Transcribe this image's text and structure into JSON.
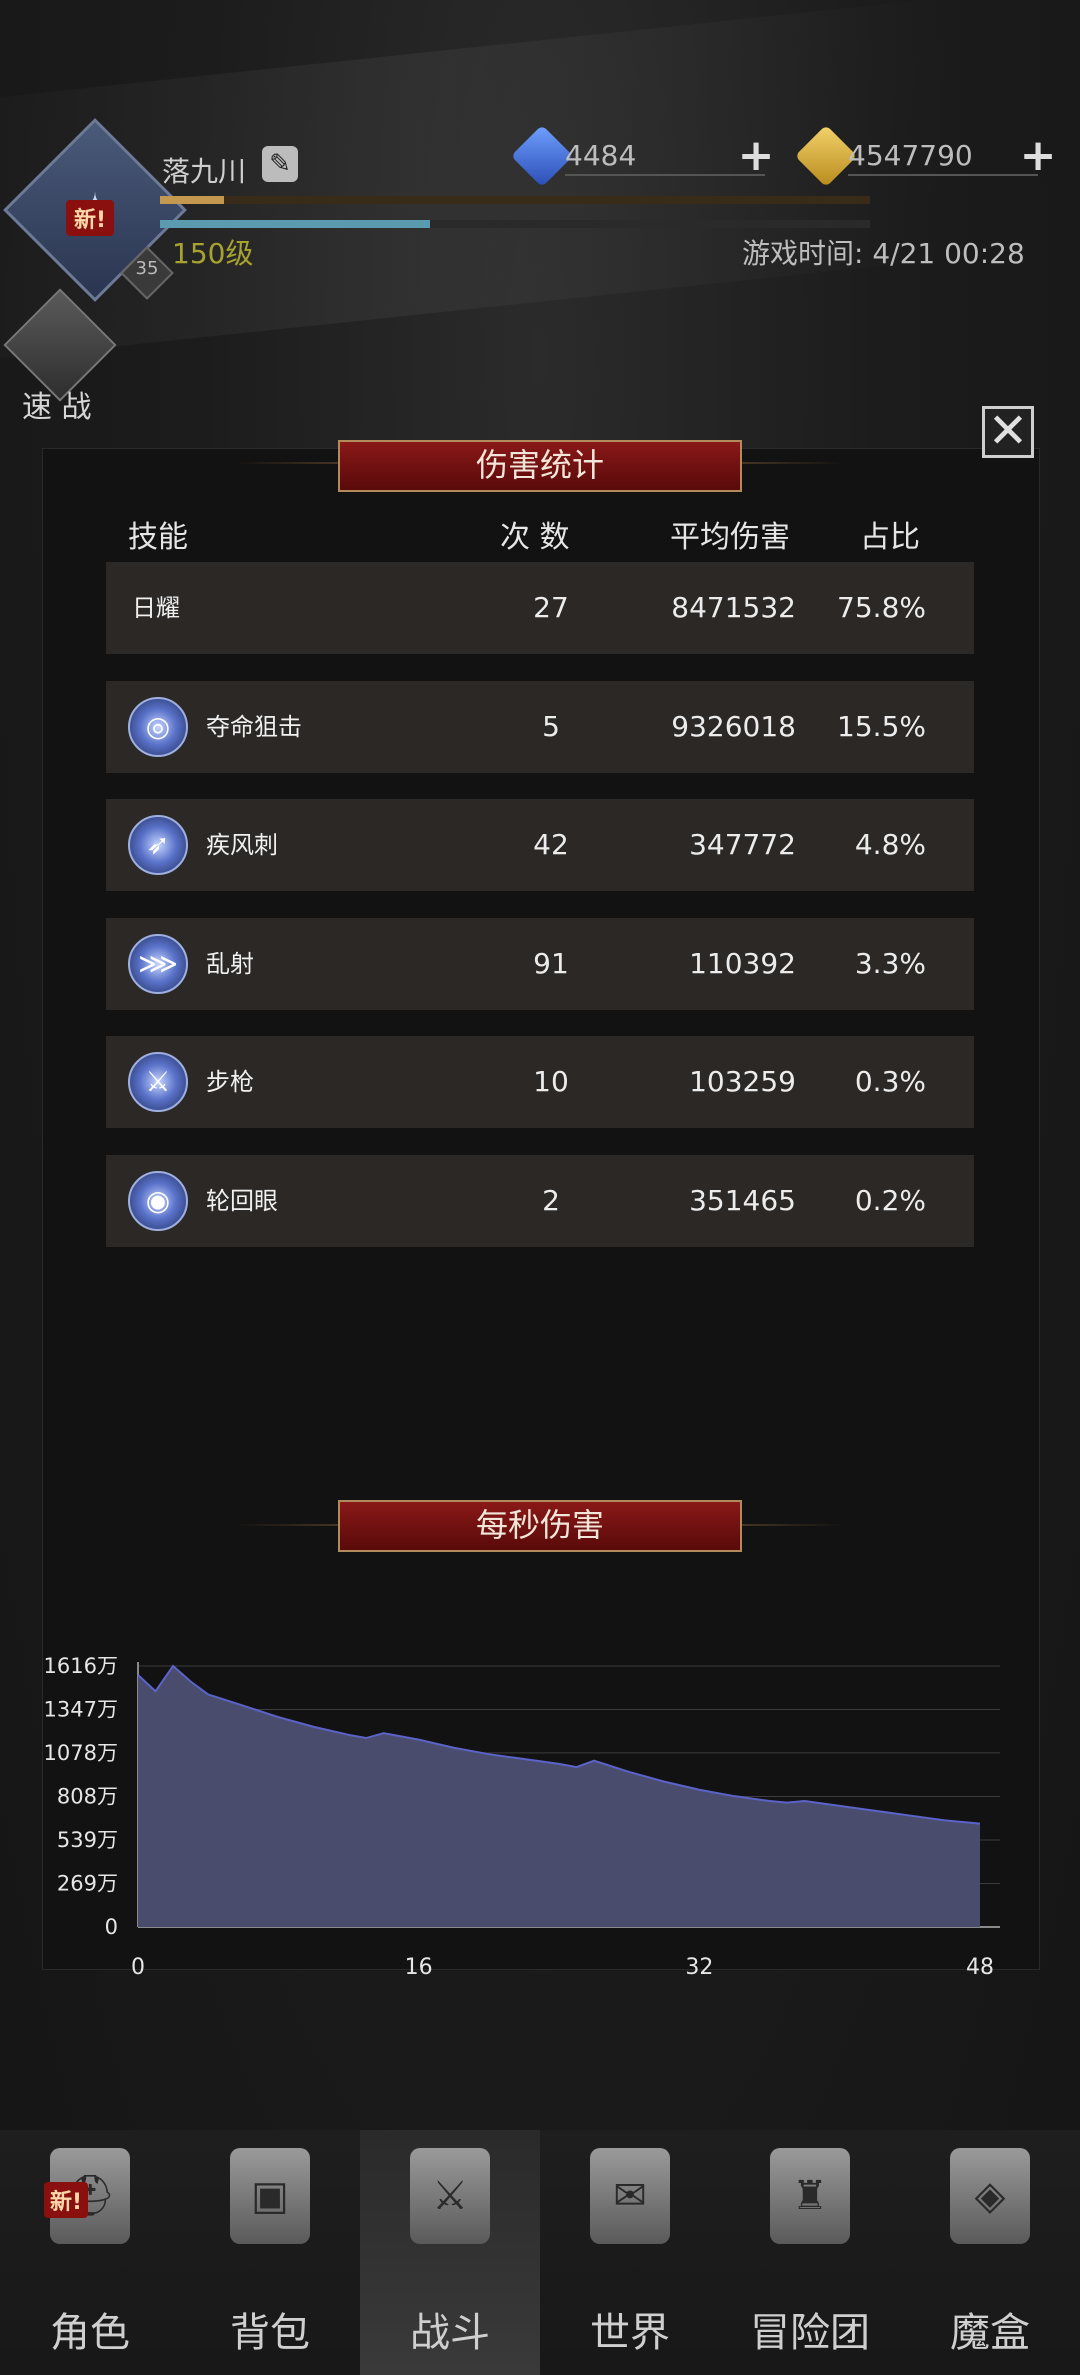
{
  "header": {
    "player_name": "落九川",
    "avatar_badge": "新!",
    "avatar_small_level": "35",
    "level": "150级",
    "gems": "4484",
    "gold": "4547790",
    "game_time": "游戏时间: 4/21 00:28",
    "exp_progress": 0.09,
    "hp_progress": 0.38,
    "quick_battle": "速 战"
  },
  "modal": {
    "close_label": "✕",
    "damage_stats": {
      "title": "伤害统计",
      "columns": [
        "技能",
        "次 数",
        "平均伤害",
        "占比"
      ],
      "rows": [
        {
          "name": "日耀",
          "count": "27",
          "avg": "8471532",
          "pct": "75.8%",
          "icon": "none"
        },
        {
          "name": "夺命狙击",
          "count": "5",
          "avg": "9326018",
          "pct": "15.5%",
          "icon": "target-skill-icon"
        },
        {
          "name": "疾风刺",
          "count": "42",
          "avg": "347772",
          "pct": "4.8%",
          "icon": "arrow-skill-icon"
        },
        {
          "name": "乱射",
          "count": "91",
          "avg": "110392",
          "pct": "3.3%",
          "icon": "multishot-skill-icon"
        },
        {
          "name": "步枪",
          "count": "10",
          "avg": "103259",
          "pct": "0.3%",
          "icon": "rifle-skill-icon"
        },
        {
          "name": "轮回眼",
          "count": "2",
          "avg": "351465",
          "pct": "0.2%",
          "icon": "eye-skill-icon"
        }
      ]
    },
    "dps": {
      "title": "每秒伤害"
    }
  },
  "chart_data": {
    "type": "area",
    "title": "每秒伤害",
    "xlabel": "",
    "ylabel": "",
    "xlim": [
      0,
      48
    ],
    "ylim": [
      0,
      1616
    ],
    "x_ticks": [
      "0",
      "16",
      "32",
      "48"
    ],
    "y_ticks": [
      "0",
      "269万",
      "539万",
      "808万",
      "1078万",
      "1347万",
      "1616万"
    ],
    "grid": true,
    "fill_color": "#4a4c6e",
    "line_color": "#5b63c9",
    "x": [
      0,
      1,
      2,
      3,
      4,
      6,
      8,
      10,
      12,
      13,
      14,
      16,
      18,
      20,
      22,
      24,
      25,
      26,
      28,
      30,
      32,
      34,
      36,
      37,
      38,
      40,
      42,
      44,
      46,
      48
    ],
    "y": [
      1560,
      1460,
      1616,
      1520,
      1440,
      1370,
      1300,
      1240,
      1190,
      1170,
      1200,
      1160,
      1110,
      1070,
      1040,
      1010,
      990,
      1030,
      960,
      900,
      850,
      810,
      780,
      770,
      780,
      750,
      720,
      690,
      660,
      640
    ]
  },
  "nav": {
    "items": [
      {
        "label": "角色",
        "icon": "helmet-icon",
        "badge": "新!"
      },
      {
        "label": "背包",
        "icon": "backpack-icon",
        "badge": ""
      },
      {
        "label": "战斗",
        "icon": "shield-sword-icon",
        "badge": ""
      },
      {
        "label": "世界",
        "icon": "map-scroll-icon",
        "badge": ""
      },
      {
        "label": "冒险团",
        "icon": "castle-icon",
        "badge": ""
      },
      {
        "label": "魔盒",
        "icon": "magic-cube-icon",
        "badge": ""
      }
    ],
    "active_index": 2
  }
}
